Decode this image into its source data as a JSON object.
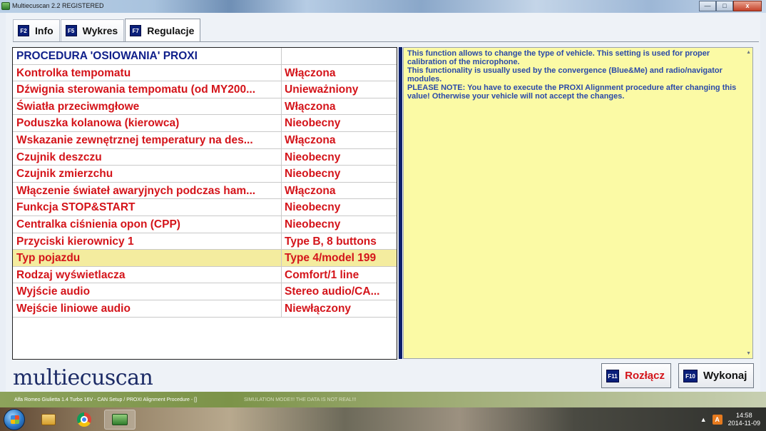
{
  "titlebar": {
    "title": "Multiecuscan 2.2 REGISTERED",
    "minimize": "—",
    "maximize": "□",
    "close": "x"
  },
  "tabs": [
    {
      "key": "F2",
      "label": "Info"
    },
    {
      "key": "F5",
      "label": "Wykres"
    },
    {
      "key": "F7",
      "label": "Regulacje"
    }
  ],
  "table": {
    "header": {
      "name": "PROCEDURA 'OSIOWANIA' PROXI",
      "value": ""
    },
    "rows": [
      {
        "name": "Kontrolka tempomatu",
        "value": "Włączona"
      },
      {
        "name": "Dźwignia sterowania tempomatu (od MY200...",
        "value": "Unieważniony"
      },
      {
        "name": "Światła przeciwmgłowe",
        "value": "Włączona"
      },
      {
        "name": "Poduszka kolanowa (kierowca)",
        "value": "Nieobecny"
      },
      {
        "name": "Wskazanie zewnętrznej temperatury na des...",
        "value": "Włączona"
      },
      {
        "name": "Czujnik deszczu",
        "value": "Nieobecny"
      },
      {
        "name": "Czujnik zmierzchu",
        "value": "Nieobecny"
      },
      {
        "name": "Włączenie świateł awaryjnych podczas ham...",
        "value": "Włączona"
      },
      {
        "name": "Funkcja STOP&START",
        "value": "Nieobecny"
      },
      {
        "name": "Centralka ciśnienia opon (CPP)",
        "value": "Nieobecny"
      },
      {
        "name": "Przyciski kierownicy 1",
        "value": "Type B, 8 buttons"
      },
      {
        "name": "Typ pojazdu",
        "value": "Type 4/model 199",
        "selected": true
      },
      {
        "name": "Rodzaj wyświetlacza",
        "value": "Comfort/1 line"
      },
      {
        "name": "Wyjście audio",
        "value": "Stereo audio/CA..."
      },
      {
        "name": "Wejście liniowe audio",
        "value": "Niewłączony"
      }
    ]
  },
  "description": {
    "line1": "This function allows to change the type of vehicle. This setting is used for proper calibration of the microphone.",
    "line2": "This functionality is usually used by the convergence (Blue&Me) and radio/navigator modules.",
    "line3": "PLEASE NOTE: You have to execute the PROXI Alignment procedure after changing this value! Otherwise your vehicle will not accept the changes."
  },
  "logo": "multiecuscan",
  "buttons": {
    "disconnect": {
      "key": "F11",
      "label": "Rozłącz"
    },
    "execute": {
      "key": "F10",
      "label": "Wykonaj"
    }
  },
  "statusbar": {
    "text": "Alfa Romeo Giulietta 1.4 Turbo 16V - CAN Setup / PROXI Alignment Procedure - []",
    "simulation": "SIMULATION MODE!!! THE DATA IS NOT REAL!!!"
  },
  "taskbar": {
    "tray_arrow": "▲",
    "tray_icon": "A",
    "time": "14:58",
    "date": "2014-11-09"
  },
  "colors": {
    "row_text": "#d4141a",
    "header_text": "#0f1f8a",
    "selected_row_bg": "#f4ec9f",
    "description_bg": "#fbfaa5",
    "description_text": "#2b4aa8"
  }
}
